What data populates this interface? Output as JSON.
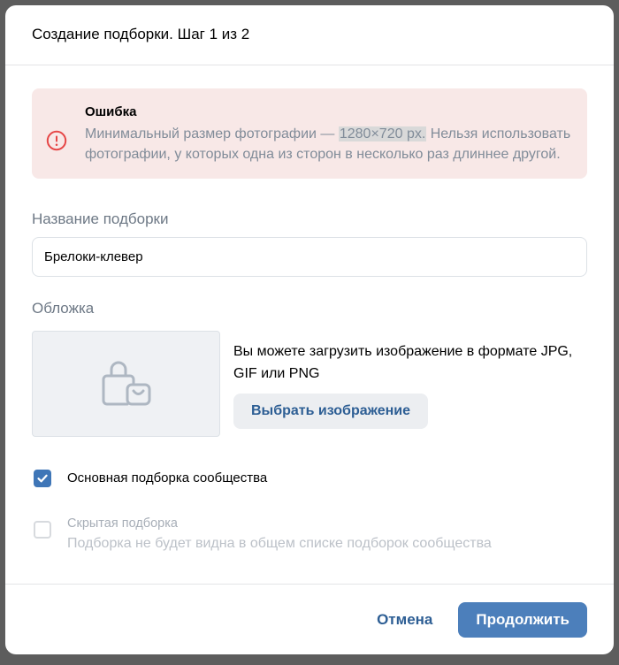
{
  "modal": {
    "title": "Создание подборки. Шаг 1 из 2"
  },
  "error": {
    "title": "Ошибка",
    "text_before": "Минимальный размер фотографии —",
    "highlight": "1280×720 px.",
    "text_after": " Нельзя использовать фотографии, у которых одна из сторон в несколько раз длиннее другой.",
    "icon": "exclamation-circle-icon",
    "color": "#e64646"
  },
  "name_field": {
    "label": "Название подборки",
    "value": "Брелоки-клевер"
  },
  "cover": {
    "label": "Обложка",
    "placeholder_icon": "shopping-bag-icon",
    "description": "Вы можете загрузить изображение в формате JPG, GIF или PNG",
    "button": "Выбрать изображение"
  },
  "options": {
    "main": {
      "label": "Основная подборка сообщества",
      "checked": true
    },
    "hidden": {
      "label": "Скрытая подборка",
      "description": "Подборка не будет видна в общем списке подборок сообщества",
      "checked": false,
      "disabled": true
    }
  },
  "footer": {
    "cancel": "Отмена",
    "continue": "Продолжить"
  },
  "colors": {
    "accent": "#4c7fbb",
    "link": "#2d5e94",
    "error_bg": "#f8e8e7"
  }
}
